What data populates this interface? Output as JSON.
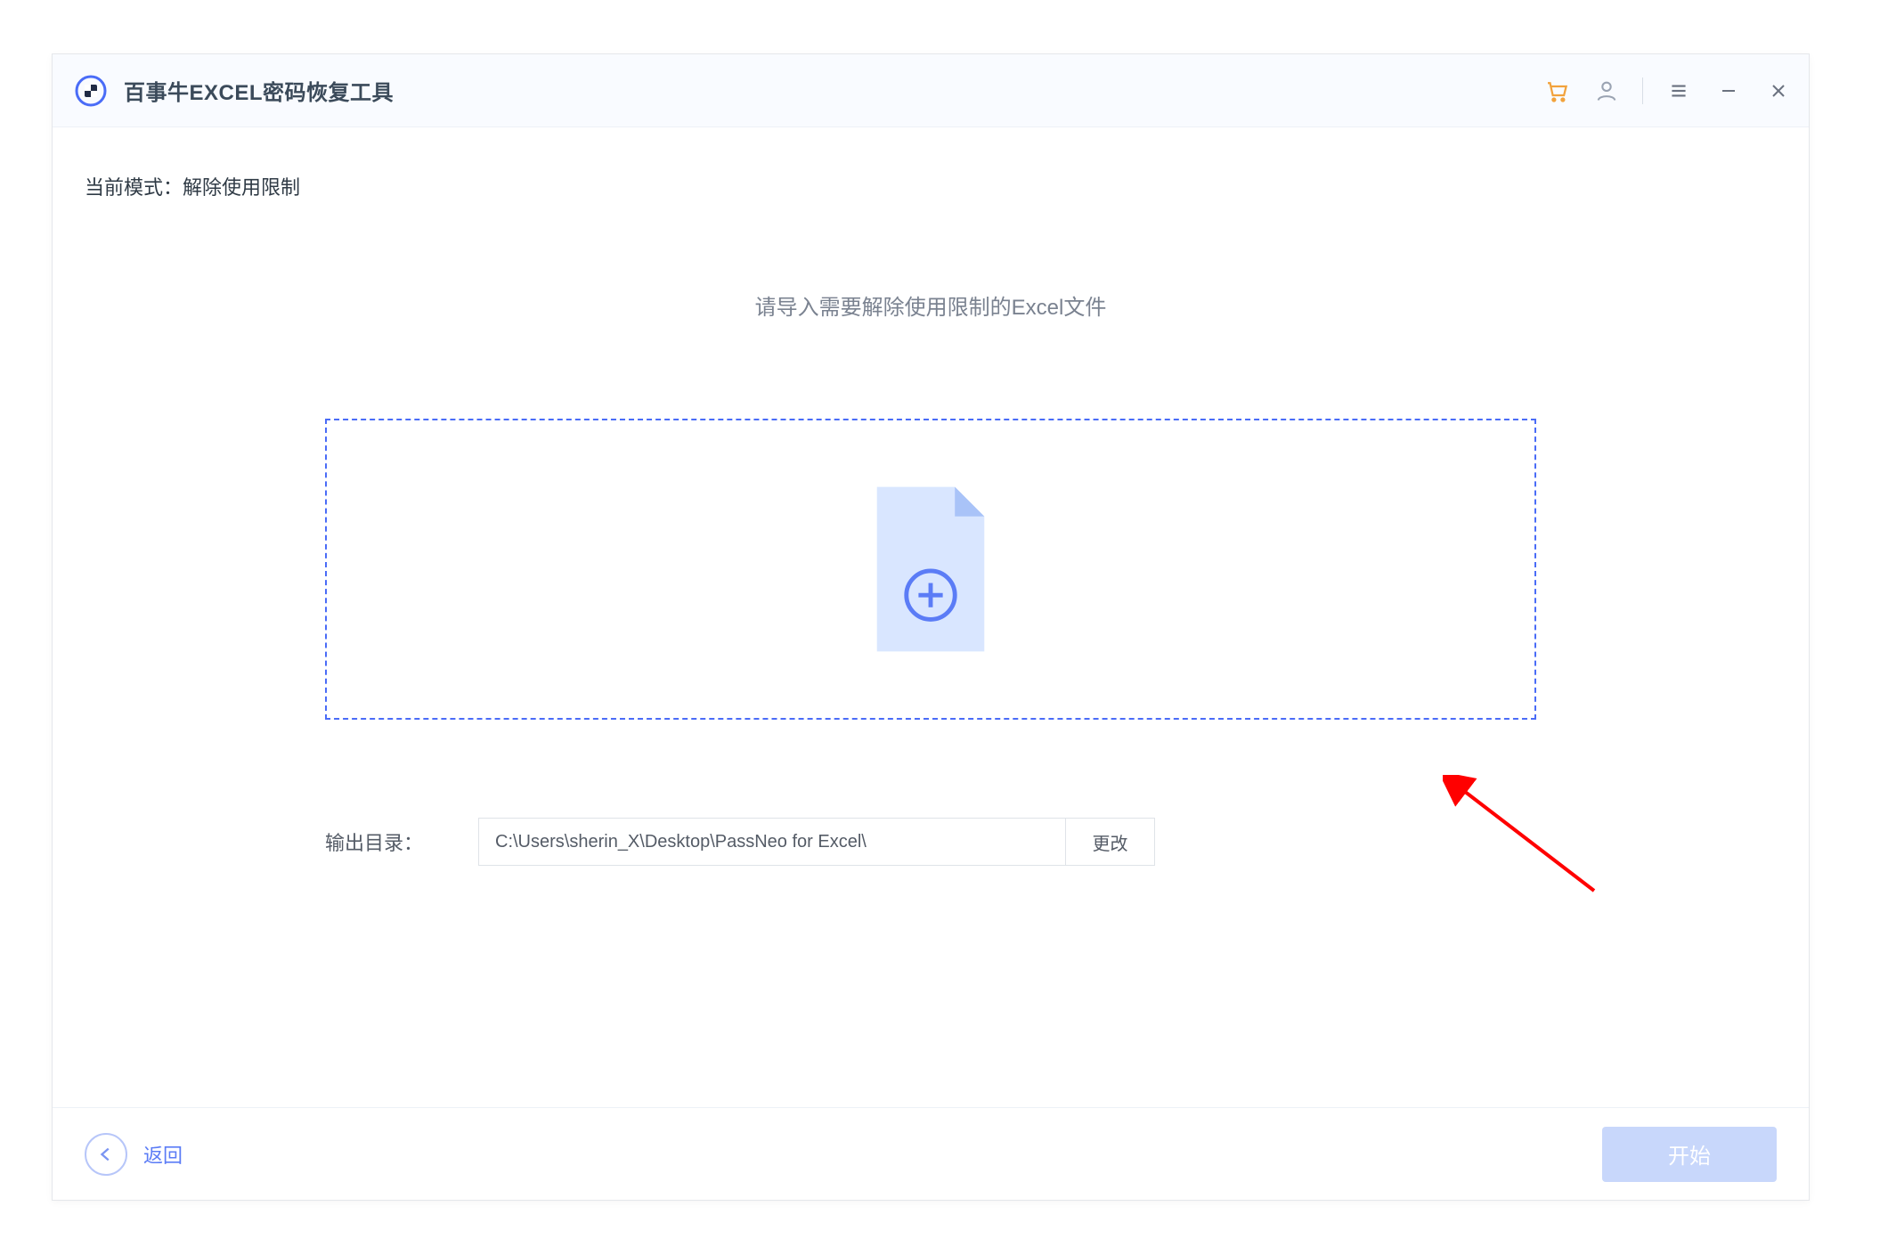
{
  "app": {
    "title": "百事牛EXCEL密码恢复工具"
  },
  "mode": {
    "prefix": "当前模式：",
    "value": "解除使用限制"
  },
  "prompt": "请导入需要解除使用限制的Excel文件",
  "output": {
    "label": "输出目录：",
    "path": "C:\\Users\\sherin_X\\Desktop\\PassNeo for Excel\\",
    "change_label": "更改"
  },
  "footer": {
    "back_label": "返回",
    "start_label": "开始"
  },
  "icons": {
    "cart": "cart-icon",
    "user": "user-icon",
    "menu": "menu-icon",
    "minimize": "minimize-icon",
    "close": "close-icon",
    "plus": "plus-icon",
    "back": "back-arrow-icon"
  },
  "colors": {
    "accent_orange": "#f2a23c",
    "accent_blue": "#4a6cf7",
    "disabled_blue": "#c8d7fb",
    "text_muted": "#7a8290",
    "border_gray": "#dfe3e8"
  }
}
